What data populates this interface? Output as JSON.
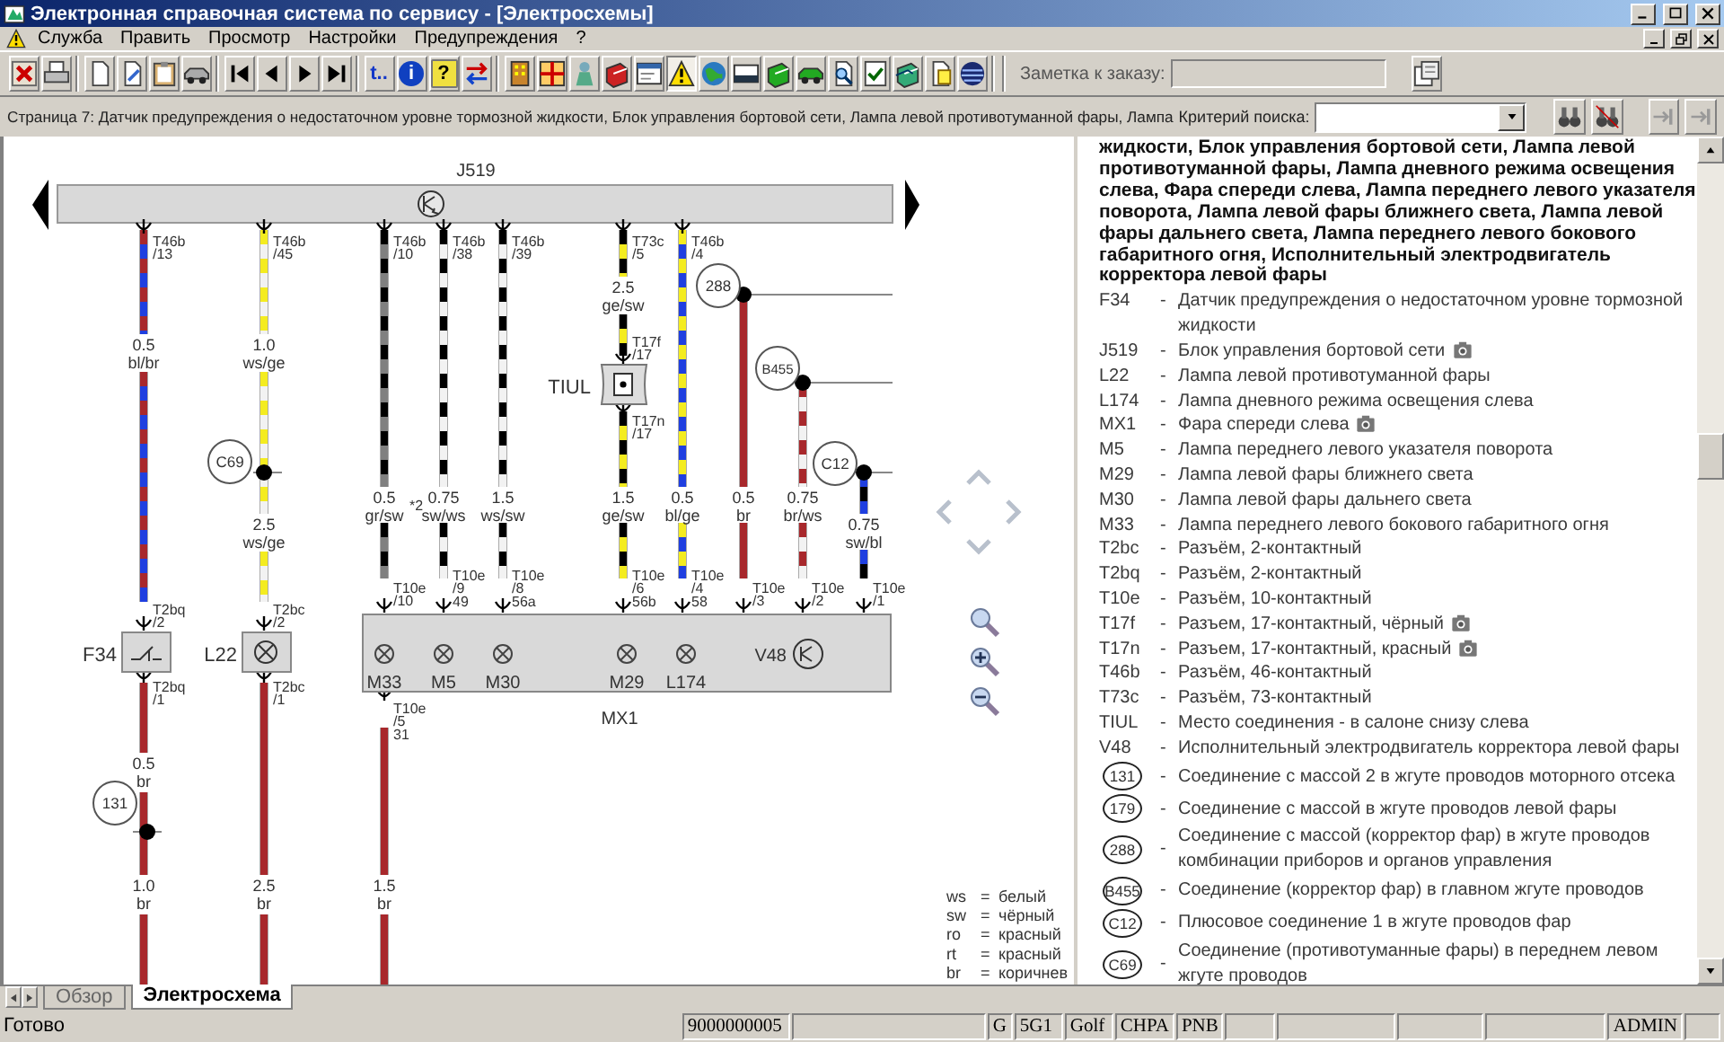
{
  "window": {
    "title": "Электронная справочная система по сервису - [Электросхемы]"
  },
  "menu": [
    {
      "label": "Служба"
    },
    {
      "label": "Править"
    },
    {
      "label": "Просмотр"
    },
    {
      "label": "Настройки"
    },
    {
      "label": "Предупреждения"
    },
    {
      "label": "?"
    }
  ],
  "toolbar": {
    "buttons": [
      {
        "kind": "icon",
        "pressed": false
      },
      {
        "kind": "icon",
        "pressed": false
      },
      {
        "kind": "separator"
      },
      {
        "kind": "icon",
        "pressed": false
      },
      {
        "kind": "icon",
        "pressed": false
      },
      {
        "kind": "icon",
        "pressed": false
      },
      {
        "kind": "icon",
        "pressed": false
      },
      {
        "kind": "separator"
      },
      {
        "kind": "icon",
        "pressed": false
      },
      {
        "kind": "icon",
        "pressed": false
      },
      {
        "kind": "icon",
        "pressed": false
      },
      {
        "kind": "icon",
        "pressed": false
      },
      {
        "kind": "separator"
      },
      {
        "kind": "text",
        "label": "t..",
        "pressed": false
      },
      {
        "kind": "glyph",
        "label": "i",
        "color": "#1040c0",
        "pressed": false
      },
      {
        "kind": "glyph",
        "label": "?",
        "color": "#f0e040",
        "pressed": false
      },
      {
        "kind": "icon",
        "pressed": false
      },
      {
        "kind": "separator"
      },
      {
        "kind": "icon",
        "pressed": false
      },
      {
        "kind": "icon",
        "pressed": false
      },
      {
        "kind": "icon",
        "pressed": false
      },
      {
        "kind": "icon",
        "pressed": false
      },
      {
        "kind": "icon",
        "pressed": false
      },
      {
        "kind": "icon",
        "pressed": true
      },
      {
        "kind": "icon",
        "pressed": false
      },
      {
        "kind": "icon",
        "pressed": false
      },
      {
        "kind": "icon",
        "pressed": false
      },
      {
        "kind": "icon",
        "pressed": false
      },
      {
        "kind": "icon",
        "pressed": false
      },
      {
        "kind": "icon",
        "pressed": false
      },
      {
        "kind": "icon",
        "pressed": false
      },
      {
        "kind": "icon",
        "pressed": false
      },
      {
        "kind": "icon",
        "pressed": false
      },
      {
        "kind": "separator"
      }
    ],
    "note_label": "Заметка к заказу:"
  },
  "info_bar": {
    "page_text": "Страница 7: Датчик предупреждения о недостаточном уровне тормозной жидкости, Блок управления бортовой сети, Лампа левой противотуманной фары, Лампа",
    "search_label": "Критерий поиска:"
  },
  "schematic": {
    "control_unit": {
      "label": "J519"
    },
    "wires": [
      {
        "color": "#1f3fe0",
        "stripe": {
          "color": "#a8282c"
        }
      },
      {
        "color": "#f2f2f2",
        "stripe": {
          "color": "#f4ec20"
        }
      },
      {
        "color": "#808080",
        "stripe": {
          "color": "#000000"
        }
      },
      {
        "color": "#f2f2f2",
        "stripe": {
          "color": "#000000"
        }
      },
      {
        "color": "#f2f2f2",
        "stripe": {
          "color": "#000000"
        }
      },
      {
        "color": "#f4ec20",
        "stripe": {
          "color": "#000000"
        }
      },
      {
        "color": "#1f3fe0",
        "stripe": {
          "color": "#f4ec20"
        }
      },
      {
        "color": "#a8282c"
      },
      {
        "color": "#f2f2f2",
        "stripe": {
          "color": "#a8282c"
        }
      },
      {
        "color": "#000000",
        "stripe": {
          "color": "#1f3fe0"
        }
      },
      {
        "color": "#a8282c"
      },
      {
        "color": "#a8282c"
      },
      {
        "color": "#a8282c"
      }
    ],
    "wire_labels": [
      {
        "size": "0.5",
        "colors": "bl/br"
      },
      {
        "size": "1.0",
        "colors": "ws/ge"
      },
      {
        "size": "2.5",
        "colors": "ws/ge"
      },
      {
        "size": "0.5",
        "colors": "gr/sw"
      },
      {
        "size": "0.75",
        "colors": "sw/ws"
      },
      {
        "size": "1.5",
        "colors": "ws/sw"
      },
      {
        "size": "2.5",
        "colors": "ge/sw"
      },
      {
        "size": "1.5",
        "colors": "ge/sw"
      },
      {
        "size": "0.5",
        "colors": "bl/ge"
      },
      {
        "size": "0.5",
        "colors": "br"
      },
      {
        "size": "0.75",
        "colors": "br/ws"
      },
      {
        "size": "0.75",
        "colors": "sw/bl"
      },
      {
        "size": "0.5",
        "colors": "br"
      },
      {
        "size": "1.0",
        "colors": "br"
      },
      {
        "size": "2.5",
        "colors": "br"
      },
      {
        "size": "1.5",
        "colors": "br"
      }
    ],
    "connectors": [
      {
        "name": "T46b",
        "pin": "/13"
      },
      {
        "name": "T46b",
        "pin": "/45"
      },
      {
        "name": "T46b",
        "pin": "/10"
      },
      {
        "name": "T46b",
        "pin": "/38"
      },
      {
        "name": "T46b",
        "pin": "/39"
      },
      {
        "name": "T73c",
        "pin": "/5"
      },
      {
        "name": "T46b",
        "pin": "/4"
      },
      {
        "name": "T17f",
        "pin": "/17"
      },
      {
        "name": "T17n",
        "pin": "/17"
      },
      {
        "name": "T2bq",
        "pin": "/2"
      },
      {
        "name": "T2bc",
        "pin": "/2"
      },
      {
        "name": "T10e",
        "pin": "/10"
      },
      {
        "name": "T10e",
        "pin": "/9",
        "terminal": "49"
      },
      {
        "name": "T10e",
        "pin": "/8",
        "terminal": "56a"
      },
      {
        "name": "T10e",
        "pin": "/6",
        "terminal": "56b"
      },
      {
        "name": "T10e",
        "pin": "/4",
        "terminal": "58"
      },
      {
        "name": "T10e",
        "pin": "/3"
      },
      {
        "name": "T10e",
        "pin": "/2"
      },
      {
        "name": "T10e",
        "pin": "/1"
      },
      {
        "name": "T2bq",
        "pin": "/1"
      },
      {
        "name": "T2bc",
        "pin": "/1"
      },
      {
        "name": "T10e",
        "pin": "/5",
        "terminal": "31"
      }
    ],
    "junctions": [
      {
        "label": "288"
      },
      {
        "label": "B455"
      },
      {
        "label": "C69"
      },
      {
        "label": "C12"
      },
      {
        "label": "131"
      }
    ],
    "components": [
      {
        "kind": "splice",
        "label": "TIUL"
      },
      {
        "kind": "switch",
        "label": "F34"
      },
      {
        "kind": "lamp",
        "label": "L22"
      }
    ],
    "note": "*2",
    "assembly": {
      "label": "MX1",
      "parts": [
        {
          "kind": "lamp",
          "label": "M33"
        },
        {
          "kind": "lamp",
          "label": "M5"
        },
        {
          "kind": "lamp",
          "label": "M30"
        },
        {
          "kind": "lamp",
          "label": "M29"
        },
        {
          "kind": "lamp",
          "label": "L174"
        },
        {
          "kind": "motor",
          "label": "V48"
        }
      ]
    },
    "color_key": [
      {
        "code": "ws",
        "eq": "=",
        "name": "белый"
      },
      {
        "code": "sw",
        "eq": "=",
        "name": "чёрный"
      },
      {
        "code": "ro",
        "eq": "=",
        "name": "красный"
      },
      {
        "code": "rt",
        "eq": "=",
        "name": "красный"
      },
      {
        "code": "br",
        "eq": "=",
        "name": "коричнев"
      }
    ]
  },
  "legend": {
    "heading": "жидкости, Блок управления бортовой сети, Лампа левой противотуманной фары, Лампа дневного режима освещения слева, Фара спереди слева, Лампа переднего левого указателя поворота, Лампа левой фары ближнего света, Лампа левой фары дальнего света, Лампа переднего левого бокового габаритного огня, Исполнительный электродвигатель корректора левой фары",
    "entries": [
      {
        "kind": "code",
        "code": "F34",
        "dash": "-",
        "description": "Датчик предупреждения о недостаточном уровне тормозной жидкости",
        "photo": false
      },
      {
        "kind": "code",
        "code": "J519",
        "dash": "-",
        "description": "Блок управления бортовой сети",
        "photo": true
      },
      {
        "kind": "code",
        "code": "L22",
        "dash": "-",
        "description": "Лампа левой противотуманной фары",
        "photo": false
      },
      {
        "kind": "code",
        "code": "L174",
        "dash": "-",
        "description": "Лампа дневного режима освещения слева",
        "photo": false
      },
      {
        "kind": "code",
        "code": "MX1",
        "dash": "-",
        "description": "Фара спереди слева",
        "photo": true
      },
      {
        "kind": "code",
        "code": "M5",
        "dash": "-",
        "description": "Лампа переднего левого указателя поворота",
        "photo": false
      },
      {
        "kind": "code",
        "code": "M29",
        "dash": "-",
        "description": "Лампа левой фары ближнего света",
        "photo": false
      },
      {
        "kind": "code",
        "code": "M30",
        "dash": "-",
        "description": "Лампа левой фары дальнего света",
        "photo": false
      },
      {
        "kind": "code",
        "code": "M33",
        "dash": "-",
        "description": "Лампа переднего левого бокового габаритного огня",
        "photo": false
      },
      {
        "kind": "code",
        "code": "T2bc",
        "dash": "-",
        "description": "Разъём, 2-контактный",
        "photo": false
      },
      {
        "kind": "code",
        "code": "T2bq",
        "dash": "-",
        "description": "Разъём, 2-контактный",
        "photo": false
      },
      {
        "kind": "code",
        "code": "T10e",
        "dash": "-",
        "description": "Разъём, 10-контактный",
        "photo": false
      },
      {
        "kind": "code",
        "code": "T17f",
        "dash": "-",
        "description": "Разъем, 17-контактный, чёрный",
        "photo": true
      },
      {
        "kind": "code",
        "code": "T17n",
        "dash": "-",
        "description": "Разъем, 17-контактный, красный",
        "photo": true
      },
      {
        "kind": "code",
        "code": "T46b",
        "dash": "-",
        "description": "Разъём, 46-контактный",
        "photo": false
      },
      {
        "kind": "code",
        "code": "T73c",
        "dash": "-",
        "description": "Разъём, 73-контактный",
        "photo": false
      },
      {
        "kind": "code",
        "code": "TIUL",
        "dash": "-",
        "description": "Место соединения - в салоне снизу слева",
        "photo": false
      },
      {
        "kind": "code",
        "code": "V48",
        "dash": "-",
        "description": "Исполнительный электродвигатель корректора левой фары",
        "photo": false
      },
      {
        "kind": "ring",
        "code": "131",
        "dash": "-",
        "description": "Соединение с массой 2 в жгуте проводов моторного отсека",
        "photo": false
      },
      {
        "kind": "ring",
        "code": "179",
        "dash": "-",
        "description": "Соединение с массой в жгуте проводов левой фары",
        "photo": false
      },
      {
        "kind": "ring",
        "code": "288",
        "dash": "-",
        "description": "Соединение с массой (корректор фар) в жгуте проводов комбинации приборов и органов управления",
        "photo": false
      },
      {
        "kind": "ring",
        "code": "B455",
        "dash": "-",
        "description": "Соединение (корректор фар) в главном жгуте проводов",
        "photo": false
      },
      {
        "kind": "ring",
        "code": "C12",
        "dash": "-",
        "description": "Плюсовое соединение 1 в жгуте проводов фар",
        "photo": false
      },
      {
        "kind": "ring",
        "code": "C69",
        "dash": "-",
        "description": "Соединение (противотуманные фары) в переднем левом жгуте проводов",
        "photo": false
      }
    ]
  },
  "sheet_tabs": [
    {
      "label": "Обзор",
      "selected": false
    },
    {
      "label": "Электросхема",
      "selected": true
    }
  ],
  "status_bar": {
    "message": "Готово",
    "panels": [
      {
        "kind": "text",
        "text": "9000000005"
      },
      {
        "kind": "blank"
      },
      {
        "kind": "text",
        "text": "G"
      },
      {
        "kind": "text",
        "text": "5G1"
      },
      {
        "kind": "text",
        "text": "Golf"
      },
      {
        "kind": "text",
        "text": "CHPA"
      },
      {
        "kind": "text",
        "text": "PNB"
      },
      {
        "kind": "blank"
      },
      {
        "kind": "blank"
      },
      {
        "kind": "blank"
      },
      {
        "kind": "blank"
      },
      {
        "kind": "text",
        "text": "ADMIN"
      },
      {
        "kind": "blank"
      }
    ]
  }
}
